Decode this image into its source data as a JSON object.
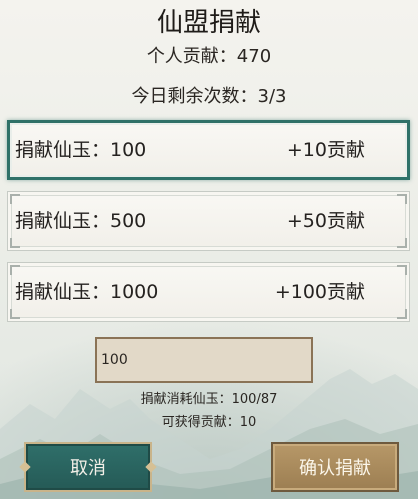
{
  "title": "仙盟捐献",
  "personal_contribution": "个人贡献：470",
  "remaining_today": "今日剩余次数：3/3",
  "options": [
    {
      "label": "捐献仙玉：100",
      "reward": "+10贡献",
      "selected": true
    },
    {
      "label": "捐献仙玉：500",
      "reward": "+50贡献",
      "selected": false
    },
    {
      "label": "捐献仙玉：1000",
      "reward": "+100贡献",
      "selected": false
    }
  ],
  "amount_input": {
    "value": "100"
  },
  "cost_text": "捐献消耗仙玉：100/87",
  "gain_text": "可获得贡献：10",
  "buttons": {
    "cancel": "取消",
    "confirm": "确认捐献"
  },
  "colors": {
    "selected_border": "#2f7168",
    "cancel_button": "#2f6f6a",
    "confirm_button": "#b79868",
    "input_background": "#e2d9c8"
  }
}
